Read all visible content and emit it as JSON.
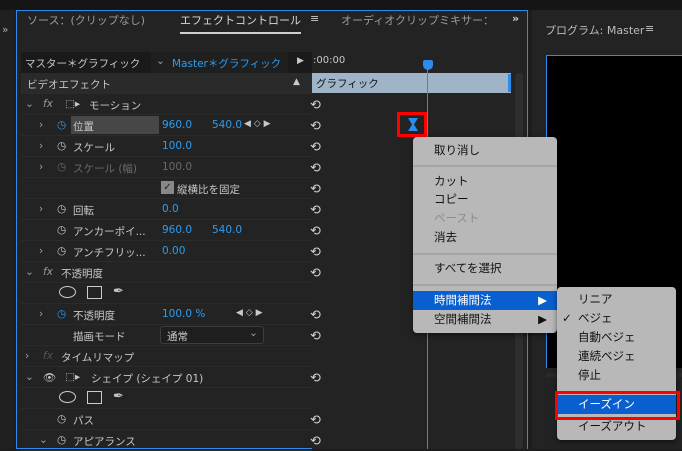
{
  "tabs": {
    "source": "ソース：(クリップなし)",
    "effect_controls": "エフェクトコントロール",
    "audio_mixer": "オーディオクリップミキサー：",
    "program": "プログラム: Master",
    "menu_icon": "≡",
    "overflow": "»"
  },
  "header": {
    "master": "マスター＊グラフィック",
    "clip": "Master＊グラフィック",
    "timecode": ":00:00",
    "clip_bar": "グラフィック"
  },
  "rows": {
    "video_effects": "ビデオエフェクト",
    "motion": "モーション",
    "position": {
      "label": "位置",
      "x": "960.0",
      "y": "540.0"
    },
    "scale": {
      "label": "スケール",
      "value": "100.0"
    },
    "scale_width": {
      "label": "スケール (幅)",
      "value": "100.0"
    },
    "uniform": "縦横比を固定",
    "rotation": {
      "label": "回転",
      "value": "0.0"
    },
    "anchor": {
      "label": "アンカーポイ...",
      "x": "960.0",
      "y": "540.0"
    },
    "antiflicker": {
      "label": "アンチフリッ...",
      "value": "0.00"
    },
    "opacity_group": "不透明度",
    "opacity": {
      "label": "不透明度",
      "value": "100.0 %"
    },
    "blend": {
      "label": "描画モード",
      "value": "通常"
    },
    "time_remap": "タイムリマップ",
    "shape": "シェイプ (シェイプ 01)",
    "path": "パス",
    "appearance": "アピアランス",
    "fx": "fx"
  },
  "context_menu": {
    "items": [
      "取り消し",
      "カット",
      "コピー",
      "ペースト",
      "消去",
      "すべてを選択",
      "時間補間法",
      "空間補間法"
    ]
  },
  "submenu": {
    "items": [
      "リニア",
      "ベジェ",
      "自動ベジェ",
      "連続ベジェ",
      "停止",
      "イーズイン",
      "イーズアウト"
    ],
    "checked": "ベジェ"
  },
  "colors": {
    "accent": "#2d9cf0",
    "highlight": "#0a5fd0",
    "annotation": "#ff0000"
  }
}
